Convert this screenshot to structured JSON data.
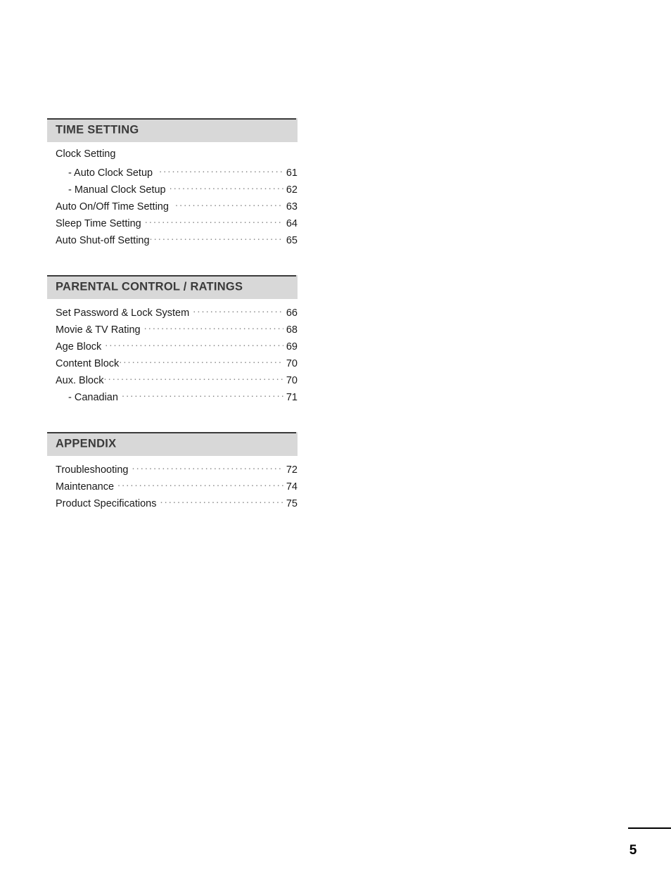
{
  "document": {
    "page_number": "5"
  },
  "toc": {
    "sections": [
      {
        "title": "TIME SETTING",
        "entries": [
          {
            "label": "Clock Setting",
            "page": "",
            "indent": false,
            "leader": false,
            "gap": "none"
          },
          {
            "label": "- Auto Clock Setup",
            "page": "61",
            "indent": true,
            "leader": true,
            "gap": "md"
          },
          {
            "label": "- Manual Clock Setup",
            "page": "62",
            "indent": true,
            "leader": true,
            "gap": "sm"
          },
          {
            "label": "Auto On/Off Time Setting",
            "page": "63",
            "indent": false,
            "leader": true,
            "gap": "md"
          },
          {
            "label": "Sleep Time Setting",
            "page": "64",
            "indent": false,
            "leader": true,
            "gap": "sm"
          },
          {
            "label": "Auto Shut-off Setting",
            "page": "65",
            "indent": false,
            "leader": true,
            "gap": "none"
          }
        ]
      },
      {
        "title": "PARENTAL CONTROL / RATINGS",
        "entries": [
          {
            "label": "Set Password & Lock System",
            "page": "66",
            "indent": false,
            "leader": true,
            "gap": "sm"
          },
          {
            "label": "Movie & TV Rating",
            "page": "68",
            "indent": false,
            "leader": true,
            "gap": "sm"
          },
          {
            "label": "Age Block",
            "page": "69",
            "indent": false,
            "leader": true,
            "gap": "sm"
          },
          {
            "label": "Content Block",
            "page": "70",
            "indent": false,
            "leader": true,
            "gap": "none"
          },
          {
            "label": "Aux. Block",
            "page": "70",
            "indent": false,
            "leader": true,
            "gap": "none"
          },
          {
            "label": "- Canadian",
            "page": "71",
            "indent": true,
            "leader": true,
            "gap": "sm"
          }
        ]
      },
      {
        "title": "APPENDIX",
        "entries": [
          {
            "label": "Troubleshooting",
            "page": "72",
            "indent": false,
            "leader": true,
            "gap": "sm"
          },
          {
            "label": "Maintenance",
            "page": "74",
            "indent": false,
            "leader": true,
            "gap": "sm"
          },
          {
            "label": "Product Specifications",
            "page": "75",
            "indent": false,
            "leader": true,
            "gap": "sm"
          }
        ]
      }
    ]
  }
}
